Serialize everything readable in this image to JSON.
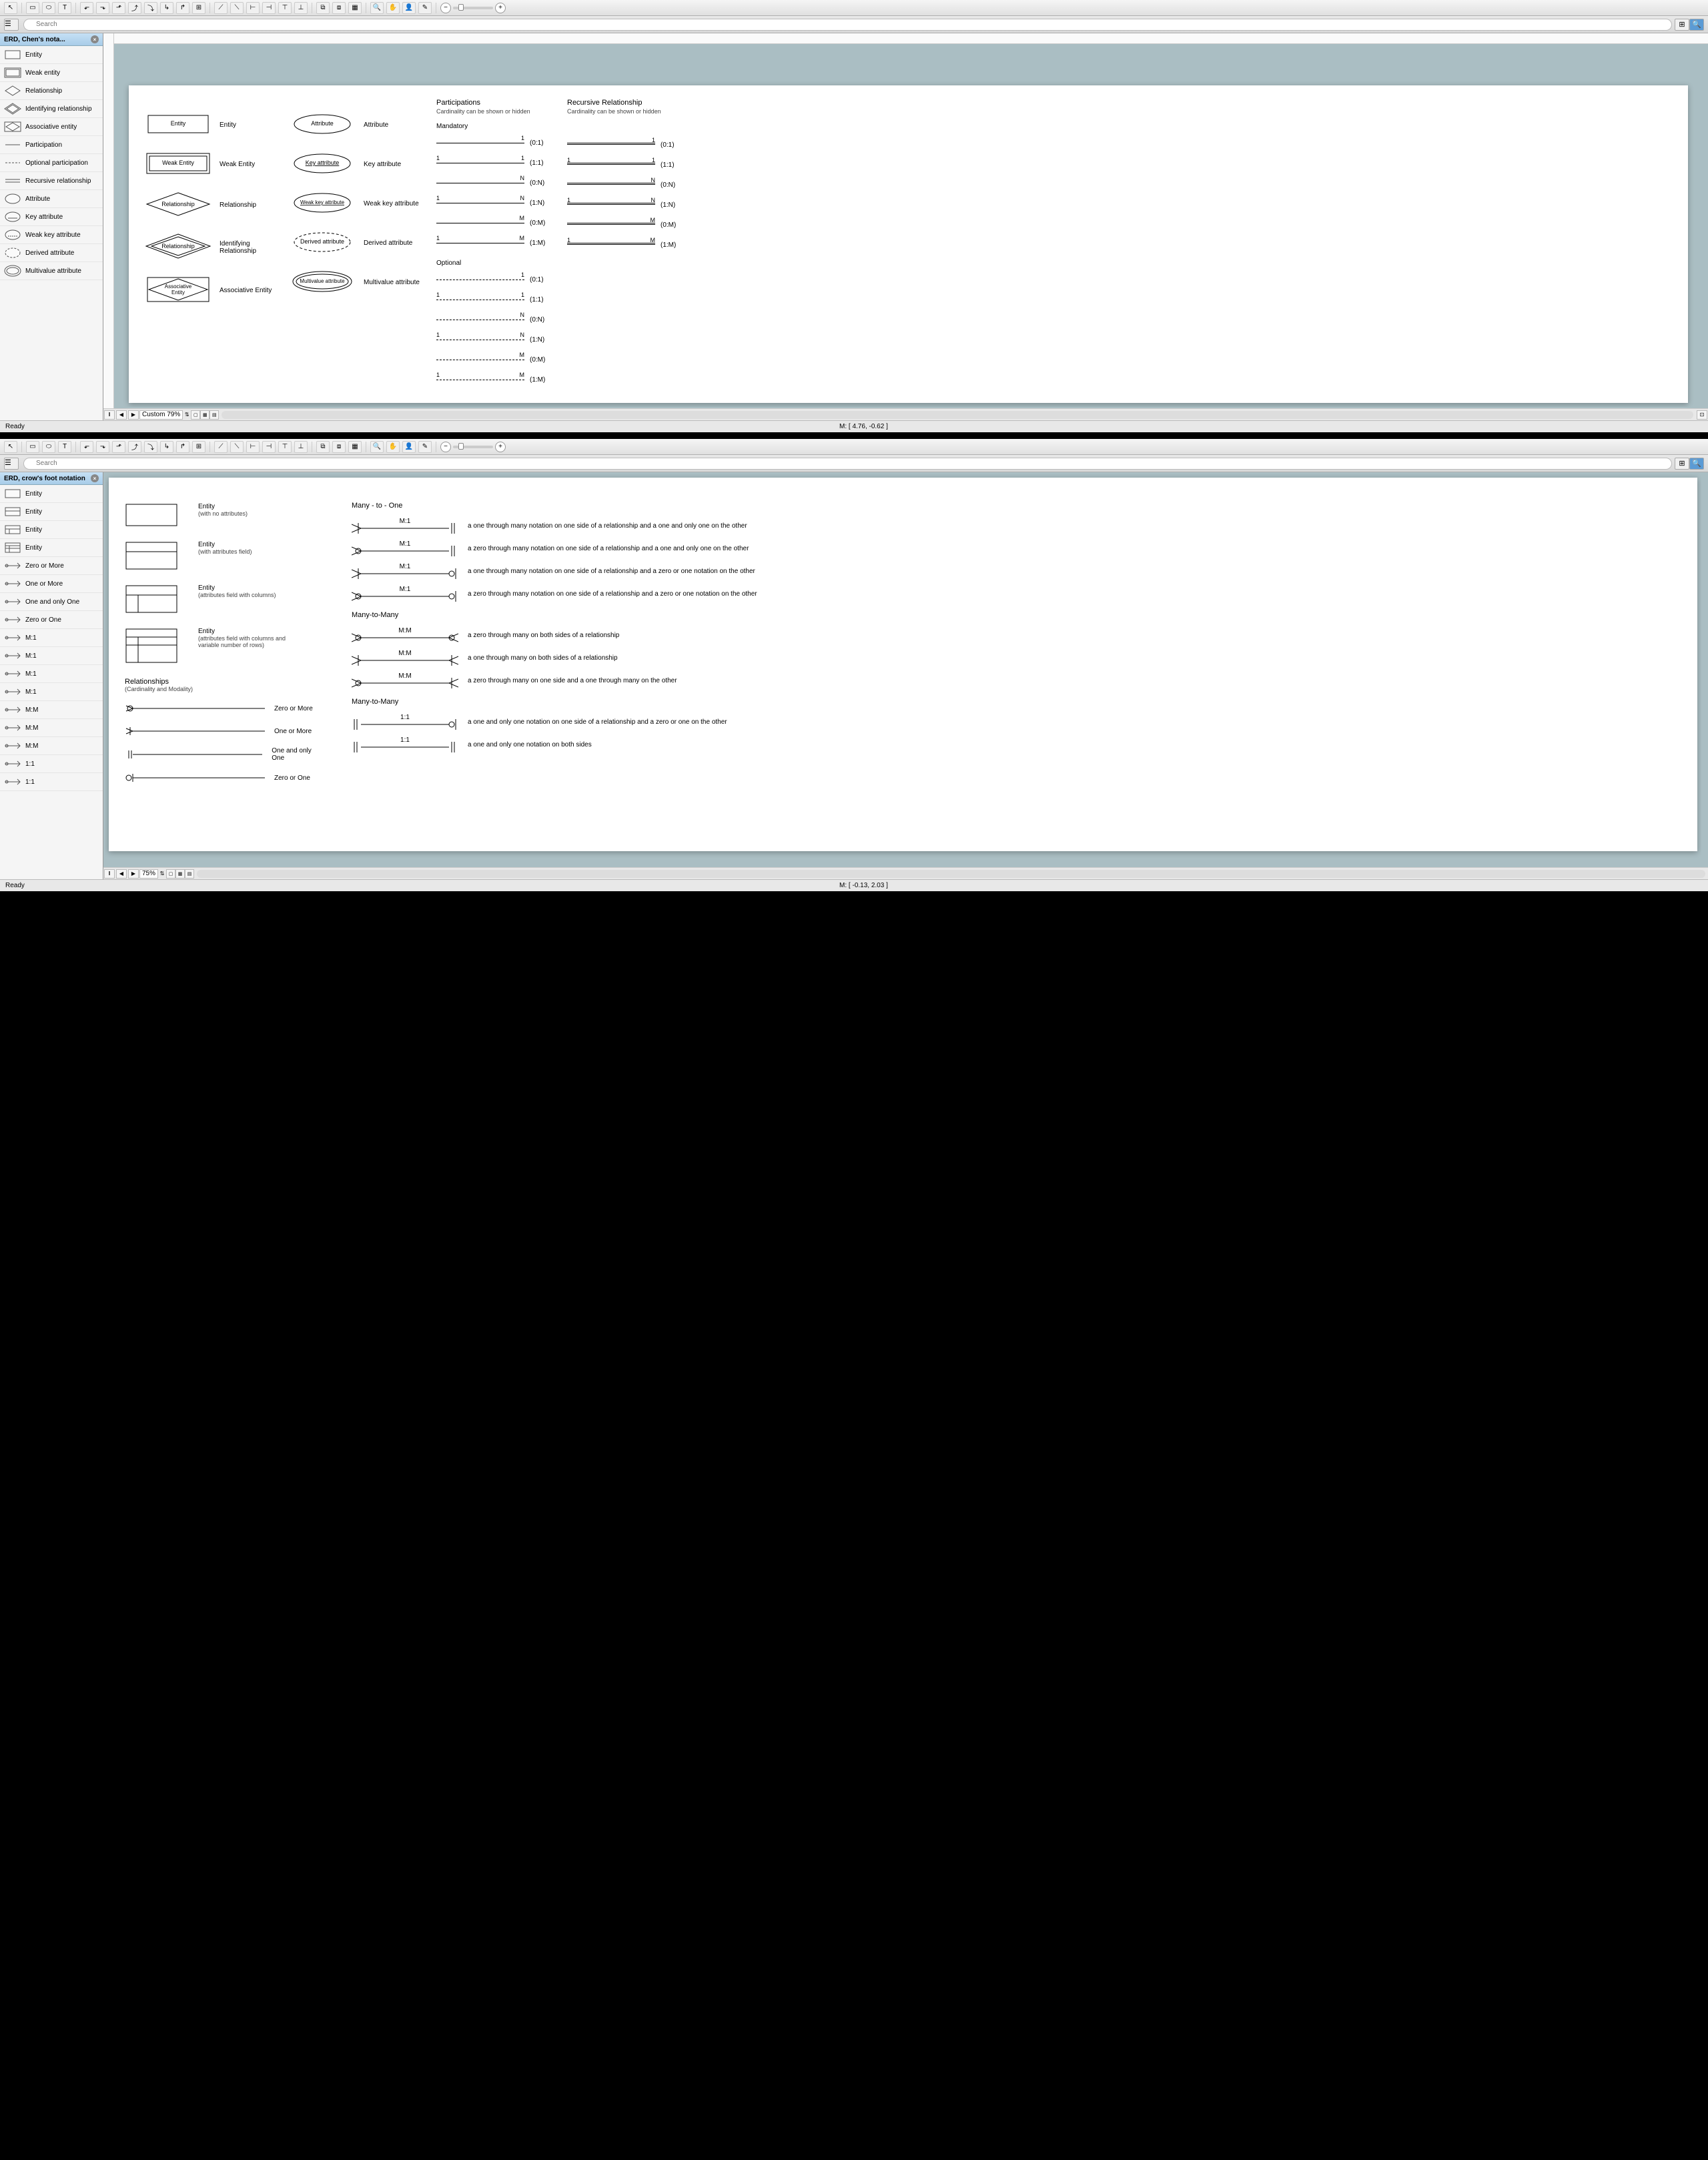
{
  "app1": {
    "toolbar_icons": [
      "pointer",
      "rect",
      "ellipse",
      "text",
      "connector",
      "route1",
      "route2",
      "route3",
      "route4",
      "route5",
      "route6",
      "insert",
      "line1",
      "line2",
      "branch1",
      "branch2",
      "branch3",
      "branch4",
      "group1",
      "group2",
      "group3",
      "zoom-in",
      "hand",
      "zoom-fit",
      "eyedrop"
    ],
    "search_placeholder": "Search",
    "panel_title": "ERD, Chen's nota...",
    "shapes": [
      {
        "label": "Entity",
        "kind": "rect"
      },
      {
        "label": "Weak entity",
        "kind": "rect-dbl"
      },
      {
        "label": "Relationship",
        "kind": "diamond"
      },
      {
        "label": "Identifying relationship",
        "kind": "diamond-dbl"
      },
      {
        "label": "Associative entity",
        "kind": "assoc"
      },
      {
        "label": "Participation",
        "kind": "line"
      },
      {
        "label": "Optional participation",
        "kind": "line-dash"
      },
      {
        "label": "Recursive relationship",
        "kind": "line-dbl"
      },
      {
        "label": "Attribute",
        "kind": "ellipse"
      },
      {
        "label": "Key attribute",
        "kind": "ellipse-key"
      },
      {
        "label": "Weak key attribute",
        "kind": "ellipse-weak"
      },
      {
        "label": "Derived attribute",
        "kind": "ellipse-dash"
      },
      {
        "label": "Multivalue attribute",
        "kind": "ellipse-dbl"
      }
    ],
    "zoom_label": "Custom 79%",
    "status_left": "Ready",
    "status_center": "M: [ 4.76, -0.62 ]",
    "page": {
      "col1": [
        {
          "svg": "rect",
          "text": "Entity",
          "label": "Entity"
        },
        {
          "svg": "rect-dbl",
          "text": "Weak Entity",
          "label": "Weak Entity"
        },
        {
          "svg": "diamond",
          "text": "Relationship",
          "label": "Relationship"
        },
        {
          "svg": "diamond-dbl",
          "text": "Relationship",
          "label": "Identifying Relationship"
        },
        {
          "svg": "assoc",
          "text": "Associative\nEntity",
          "label": "Associative Entity"
        }
      ],
      "col2": [
        {
          "svg": "ellipse",
          "text": "Attribute",
          "label": "Attribute"
        },
        {
          "svg": "ellipse-key",
          "text": "Key attribute",
          "label": "Key attribute"
        },
        {
          "svg": "ellipse-weak",
          "text": "Weak key attribute",
          "label": "Weak key attribute"
        },
        {
          "svg": "ellipse-dash",
          "text": "Derived attribute",
          "label": "Derived attribute"
        },
        {
          "svg": "ellipse-dbl",
          "text": "Multivalue attribute",
          "label": "Multivalue attribute"
        }
      ],
      "col3_title": "Participations",
      "col3_sub": "Cardinality can be shown or hidden",
      "col4_title": "Recursive Relationship",
      "col4_sub": "Cardinality can be shown or hidden",
      "mandatory_label": "Mandatory",
      "optional_label": "Optional",
      "mandatory": [
        {
          "l": "",
          "r": "1",
          "card": "(0:1)"
        },
        {
          "l": "1",
          "r": "1",
          "card": "(1:1)"
        },
        {
          "l": "",
          "r": "N",
          "card": "(0:N)"
        },
        {
          "l": "1",
          "r": "N",
          "card": "(1:N)"
        },
        {
          "l": "",
          "r": "M",
          "card": "(0:M)"
        },
        {
          "l": "1",
          "r": "M",
          "card": "(1:M)"
        }
      ],
      "recursive": [
        {
          "l": "",
          "r": "1",
          "card": "(0:1)"
        },
        {
          "l": "1",
          "r": "1",
          "card": "(1:1)"
        },
        {
          "l": "",
          "r": "N",
          "card": "(0:N)"
        },
        {
          "l": "1",
          "r": "N",
          "card": "(1:N)"
        },
        {
          "l": "",
          "r": "M",
          "card": "(0:M)"
        },
        {
          "l": "1",
          "r": "M",
          "card": "(1:M)"
        }
      ],
      "optional": [
        {
          "l": "",
          "r": "1",
          "card": "(0:1)"
        },
        {
          "l": "1",
          "r": "1",
          "card": "(1:1)"
        },
        {
          "l": "",
          "r": "N",
          "card": "(0:N)"
        },
        {
          "l": "1",
          "r": "N",
          "card": "(1:N)"
        },
        {
          "l": "",
          "r": "M",
          "card": "(0:M)"
        },
        {
          "l": "1",
          "r": "M",
          "card": "(1:M)"
        }
      ]
    }
  },
  "app2": {
    "toolbar_icons": [
      "pointer",
      "rect",
      "ellipse",
      "text",
      "connector",
      "route1",
      "route2",
      "route3",
      "route4",
      "route5",
      "route6",
      "insert",
      "line1",
      "line2",
      "branch1",
      "branch2",
      "branch3",
      "branch4",
      "group1",
      "group2",
      "group3",
      "zoom-in",
      "hand",
      "zoom-fit",
      "eyedrop"
    ],
    "search_placeholder": "Search",
    "panel_title": "ERD, crow's foot notation",
    "shapes": [
      {
        "label": "Entity",
        "kind": "rect-plain"
      },
      {
        "label": "Entity",
        "kind": "rect-header"
      },
      {
        "label": "Entity",
        "kind": "rect-cols"
      },
      {
        "label": "Entity",
        "kind": "rect-rows"
      },
      {
        "label": "Zero or More",
        "kind": "cf-0m"
      },
      {
        "label": "One or More",
        "kind": "cf-1m"
      },
      {
        "label": "One and only One",
        "kind": "cf-11"
      },
      {
        "label": "Zero or One",
        "kind": "cf-01"
      },
      {
        "label": "M:1",
        "kind": "m1-a"
      },
      {
        "label": "M:1",
        "kind": "m1-b"
      },
      {
        "label": "M:1",
        "kind": "m1-c"
      },
      {
        "label": "M:1",
        "kind": "m1-d"
      },
      {
        "label": "M:M",
        "kind": "mm-a"
      },
      {
        "label": "M:M",
        "kind": "mm-b"
      },
      {
        "label": "M:M",
        "kind": "mm-c"
      },
      {
        "label": "1:1",
        "kind": "11-a"
      },
      {
        "label": "1:1",
        "kind": "11-b"
      }
    ],
    "zoom_label": "75%",
    "status_left": "Ready",
    "status_center": "M: [ -0.13, 2.03 ]",
    "page": {
      "entities": [
        {
          "title": "Entity",
          "sub": "(with no attributes)"
        },
        {
          "title": "Entity",
          "sub": "(with attributes field)"
        },
        {
          "title": "Entity",
          "sub": "(attributes field with columns)"
        },
        {
          "title": "Entity",
          "sub": "(attributes field with columns and variable number of rows)"
        }
      ],
      "relationships_hdr": "Relationships",
      "relationships_sub": "(Cardinality and Modality)",
      "basic_rels": [
        {
          "label": "Zero or More",
          "left": "cf-0m-l"
        },
        {
          "label": "One or More",
          "left": "cf-1m-l"
        },
        {
          "label": "One and only One",
          "left": "cf-11-l"
        },
        {
          "label": "Zero or One",
          "left": "cf-01-l"
        }
      ],
      "m1_hdr": "Many - to - One",
      "m1": [
        {
          "label": "M:1",
          "desc": "a one through many notation on one side of a relationship and a one and only one on the other"
        },
        {
          "label": "M:1",
          "desc": "a zero through many notation on one side of a relationship and a one and only one on the other"
        },
        {
          "label": "M:1",
          "desc": "a one through many notation on one side of a relationship and a zero or one notation on the other"
        },
        {
          "label": "M:1",
          "desc": "a zero through many notation on one side of a relationship and a zero or one notation on the other"
        }
      ],
      "mm_hdr": "Many-to-Many",
      "mm": [
        {
          "label": "M:M",
          "desc": "a zero through many on both sides of a relationship"
        },
        {
          "label": "M:M",
          "desc": "a one through many on both sides of a relationship"
        },
        {
          "label": "M:M",
          "desc": "a zero through many on one side and a one through many on the other"
        }
      ],
      "oo_hdr": "Many-to-Many",
      "oo": [
        {
          "label": "1:1",
          "desc": "a one and only one notation on one side of a relationship and a zero or one on the other"
        },
        {
          "label": "1:1",
          "desc": "a one and only one notation on both sides"
        }
      ]
    }
  }
}
